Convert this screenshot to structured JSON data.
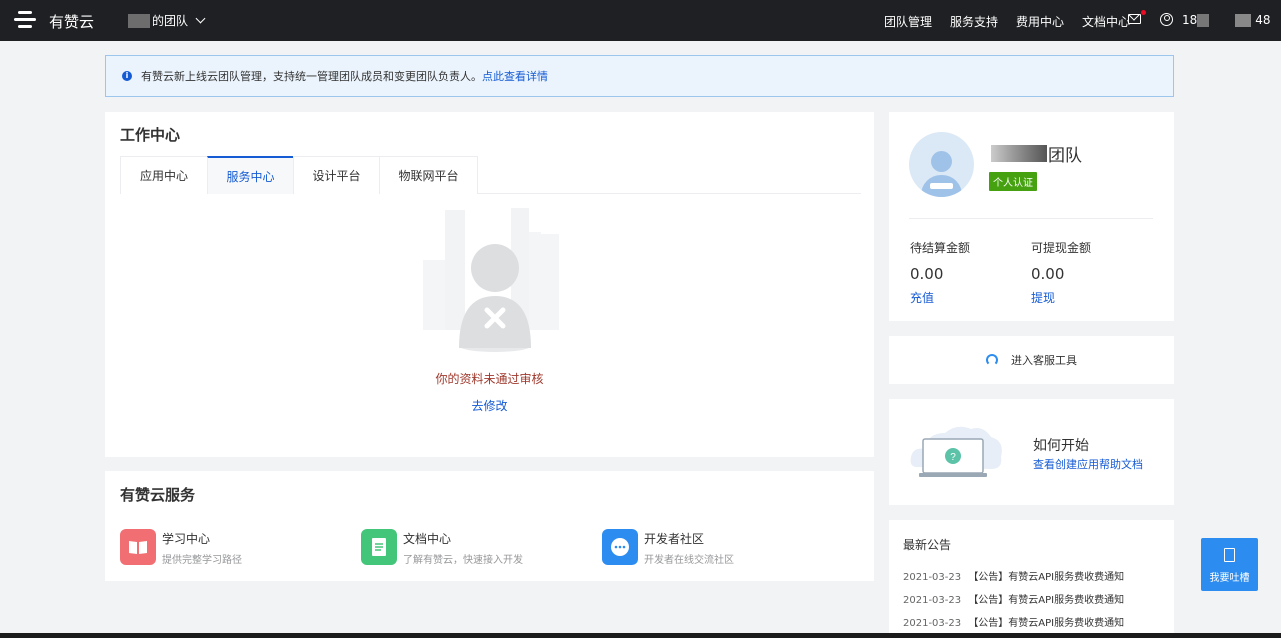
{
  "topbar": {
    "brand": "有赞云",
    "team_suffix": "的团队",
    "nav": [
      "团队管理",
      "服务支持",
      "费用中心",
      "文档中心"
    ],
    "user_prefix": "18",
    "user_suffix": "48"
  },
  "notice": {
    "text": "有赞云新上线云团队管理，支持统一管理团队成员和变更团队负责人。",
    "link": "点此查看详情"
  },
  "work_center": {
    "title": "工作中心",
    "tabs": [
      "应用中心",
      "服务中心",
      "设计平台",
      "物联网平台"
    ],
    "active_tab": "服务中心",
    "empty_message": "你的资料未通过审核",
    "empty_action": "去修改"
  },
  "services": {
    "title": "有赞云服务",
    "items": [
      {
        "title": "学习中心",
        "subtitle": "提供完整学习路径",
        "icon": "book-icon",
        "color": "#f16e72"
      },
      {
        "title": "文档中心",
        "subtitle": "了解有赞云，快速接入开发",
        "icon": "document-icon",
        "color": "#43c57a"
      },
      {
        "title": "开发者社区",
        "subtitle": "开发者在线交流社区",
        "icon": "chat-bubble-icon",
        "color": "#2d8cf0"
      }
    ]
  },
  "profile": {
    "team_suffix": "团队",
    "cert_tag": "个人认证",
    "pending_label": "待结算金额",
    "pending_value": "0.00",
    "pending_action": "充值",
    "withdraw_label": "可提现金额",
    "withdraw_value": "0.00",
    "withdraw_action": "提现"
  },
  "customer_service": {
    "label": "进入客服工具"
  },
  "howto": {
    "title": "如何开始",
    "link": "查看创建应用帮助文档"
  },
  "announcements": {
    "title": "最新公告",
    "items": [
      {
        "date": "2021-03-23",
        "text": "【公告】有赞云API服务费收费通知"
      },
      {
        "date": "2021-03-23",
        "text": "【公告】有赞云API服务费收费通知"
      },
      {
        "date": "2021-03-23",
        "text": "【公告】有赞云API服务费收费通知"
      }
    ]
  },
  "feedback": {
    "label": "我要吐槽"
  },
  "colors": {
    "accent": "#155bd4",
    "topbar": "#1f2023",
    "error_text": "#a0392d",
    "cert_green": "#45a110"
  }
}
